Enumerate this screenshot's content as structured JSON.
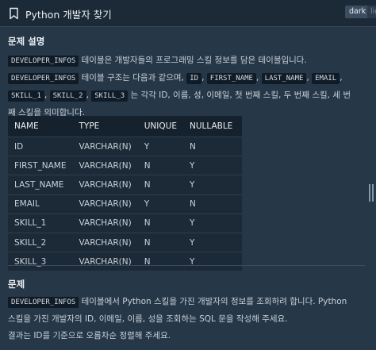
{
  "header": {
    "title": "Python 개발자 찾기",
    "theme_dark": "dark",
    "theme_light": "light"
  },
  "section1": {
    "heading": "문제 설명",
    "p1_code": "DEVELOPER_INFOS",
    "p1_text": "테이블은 개발자들의 프로그래밍 스킬 정보를 담은 테이블입니다.",
    "p2_code": "DEVELOPER_INFOS",
    "p2_text1": "테이블 구조는 다음과 같으며,",
    "cols": [
      "ID",
      "FIRST_NAME",
      "LAST_NAME",
      "EMAIL",
      "SKILL_1",
      "SKILL_2",
      "SKILL_3"
    ],
    "p2_text2": "는 각각 ID, 이름, 성, 이메일, 첫 번째 스킬, 두 번째 스킬, 세 번째 스킬을 의미합니다."
  },
  "table": {
    "headers": [
      "NAME",
      "TYPE",
      "UNIQUE",
      "NULLABLE"
    ],
    "rows": [
      [
        "ID",
        "VARCHAR(N)",
        "Y",
        "N"
      ],
      [
        "FIRST_NAME",
        "VARCHAR(N)",
        "N",
        "Y"
      ],
      [
        "LAST_NAME",
        "VARCHAR(N)",
        "N",
        "Y"
      ],
      [
        "EMAIL",
        "VARCHAR(N)",
        "Y",
        "N"
      ],
      [
        "SKILL_1",
        "VARCHAR(N)",
        "N",
        "Y"
      ],
      [
        "SKILL_2",
        "VARCHAR(N)",
        "N",
        "Y"
      ],
      [
        "SKILL_3",
        "VARCHAR(N)",
        "N",
        "Y"
      ]
    ]
  },
  "section2": {
    "heading": "문제",
    "code": "DEVELOPER_INFOS",
    "text": "테이블에서 Python 스킬을 가진 개발자의 정보를 조회하려 합니다. Python 스킬을 가진 개발자의 ID, 이메일, 이름, 성을 조회하는 SQL 문을 작성해 주세요.",
    "note": "결과는 ID를 기준으로 오름차순 정렬해 주세요."
  },
  "icons": {
    "bookmark": "bookmark-icon"
  },
  "colors": {
    "background": "#263747",
    "header": "#1c2a37",
    "code_bg": "#0f1b26",
    "table_bg": "#1c2a37"
  }
}
